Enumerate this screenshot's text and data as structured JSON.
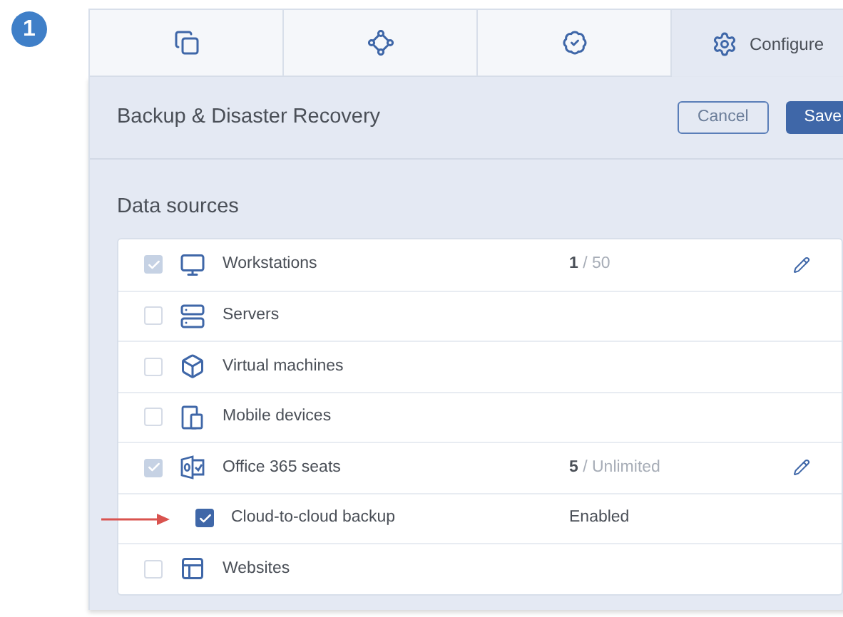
{
  "step_badge": "1",
  "tabs": [
    {
      "selected": false
    },
    {
      "selected": false
    },
    {
      "selected": false
    },
    {
      "label": "Configure",
      "selected": true
    }
  ],
  "header": {
    "title": "Backup & Disaster Recovery",
    "buttons": [
      {
        "label": "Cancel",
        "kind": "secondary"
      },
      {
        "label": "Save",
        "kind": "primary"
      }
    ]
  },
  "section_title": "Data sources",
  "rows": [
    {
      "kind": "item",
      "label": "Workstations",
      "checked": true,
      "disabled": true,
      "used": "1",
      "limit": "/ 50",
      "editable": true
    },
    {
      "kind": "item",
      "label": "Servers",
      "checked": false,
      "disabled": false
    },
    {
      "kind": "item",
      "label": "Virtual machines",
      "checked": false,
      "disabled": false
    },
    {
      "kind": "item",
      "label": "Mobile devices",
      "checked": false,
      "disabled": false
    },
    {
      "kind": "item",
      "label": "Office 365 seats",
      "checked": true,
      "disabled": true,
      "used": "5",
      "limit": "/ Unlimited",
      "editable": true
    },
    {
      "kind": "sub",
      "label": "Cloud-to-cloud backup",
      "checked": true,
      "disabled": false,
      "status": "Enabled",
      "pointed": true
    },
    {
      "kind": "item",
      "label": "Websites",
      "checked": false,
      "disabled": false
    }
  ]
}
